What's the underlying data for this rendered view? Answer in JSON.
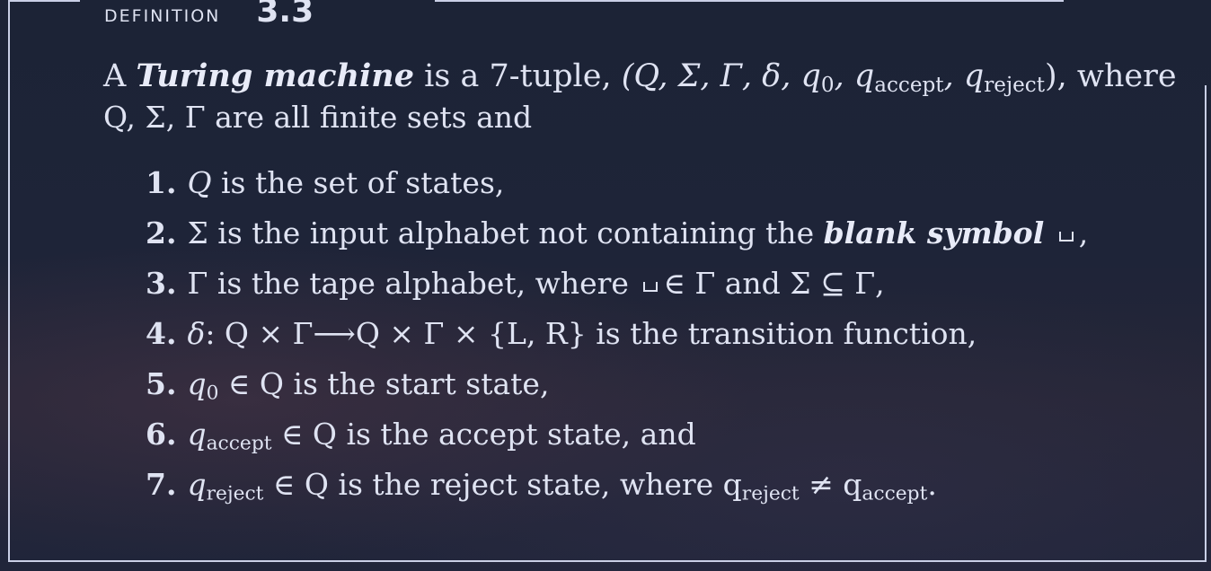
{
  "heading": {
    "label": "DEFINITION",
    "number": "3.3"
  },
  "intro": {
    "a": "A",
    "term": "Turing machine",
    "is_a": "is a 7-tuple,",
    "tuple_open": "(Q, Σ, Γ, δ, q",
    "sub0": "0",
    "comma1": ", q",
    "sub_accept": "accept",
    "comma2": ", q",
    "sub_reject": "reject",
    "tuple_close": "),",
    "where": "where",
    "line2": "Q, Σ, Γ are all finite sets and"
  },
  "items": [
    {
      "n": "1.",
      "t1": "Q",
      "t2": " is the set of states,"
    },
    {
      "n": "2.",
      "t1": "Σ is the input alphabet not containing the",
      "term": "blank symbol",
      "t2": ","
    },
    {
      "n": "3.",
      "t1": "Γ is the tape alphabet, where",
      "t2": "∈ Γ and Σ ⊆ Γ,"
    },
    {
      "n": "4.",
      "t1": "δ",
      "t2": ": Q × Γ⟶Q × Γ × {L, R} is the transition function,"
    },
    {
      "n": "5.",
      "t1": "q",
      "sub": "0",
      "t2": " ∈ Q is the start state,"
    },
    {
      "n": "6.",
      "t1": "q",
      "sub": "accept",
      "t2": " ∈ Q is the accept state, and"
    },
    {
      "n": "7.",
      "t1": "q",
      "sub": "reject",
      "t2": " ∈ Q is the reject state, where q",
      "sub2": "reject",
      "t3": " ≠ q",
      "sub3": "accept",
      "t4": "."
    }
  ]
}
